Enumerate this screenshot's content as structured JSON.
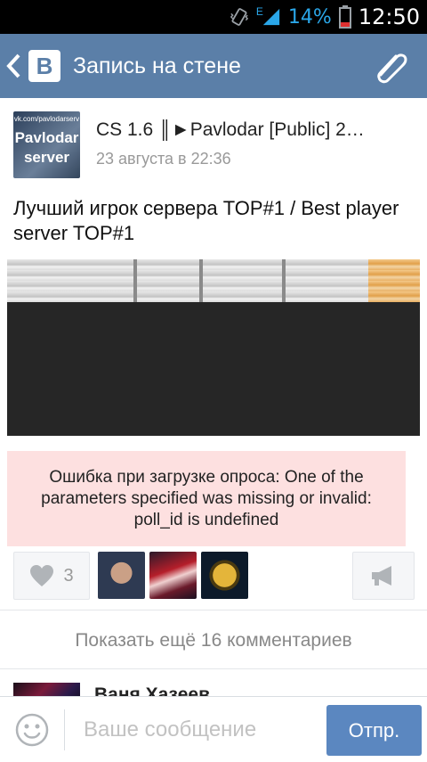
{
  "status_bar": {
    "network": "E",
    "battery": "14%",
    "time": "12:50"
  },
  "header": {
    "logo": "В",
    "title": "Запись на стене"
  },
  "post": {
    "author_avatar": {
      "small_text": "vk.com/pavlodarserv",
      "big_text": "Pavlodar server"
    },
    "author": "CS 1.6 ║►Pavlodar [Public] 2…",
    "date": "23 августа в 22:36",
    "text": "Лучший игрок сервера TOP#1 / Best player server TOP#1",
    "error": "Ошибка при загрузке опроса: One of the parameters specified was missing or invalid: poll_id is undefined",
    "likes": {
      "count": "3"
    }
  },
  "comments": {
    "show_more": "Показать ещё 16 комментариев",
    "first": {
      "name": "Ваня Хазеев"
    }
  },
  "composer": {
    "placeholder": "Ваше сообщение",
    "send_label": "Отпр."
  },
  "colors": {
    "header_bg": "#5b7fa8",
    "send_bg": "#5b87c0",
    "error_bg": "#fde0e0"
  }
}
